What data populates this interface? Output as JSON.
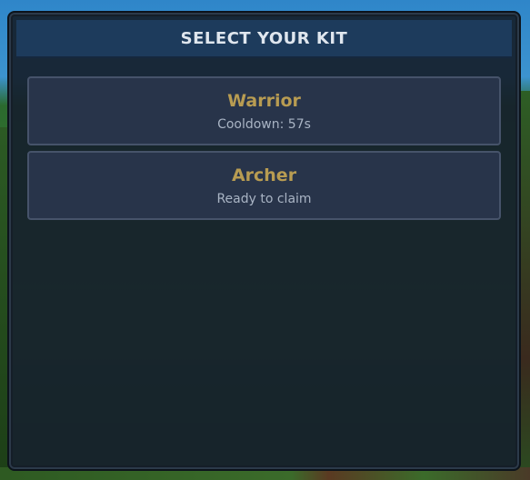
{
  "panel": {
    "title": "SELECT YOUR KIT"
  },
  "kits": [
    {
      "name": "Warrior",
      "status": "Cooldown: 57s"
    },
    {
      "name": "Archer",
      "status": "Ready to claim"
    }
  ]
}
